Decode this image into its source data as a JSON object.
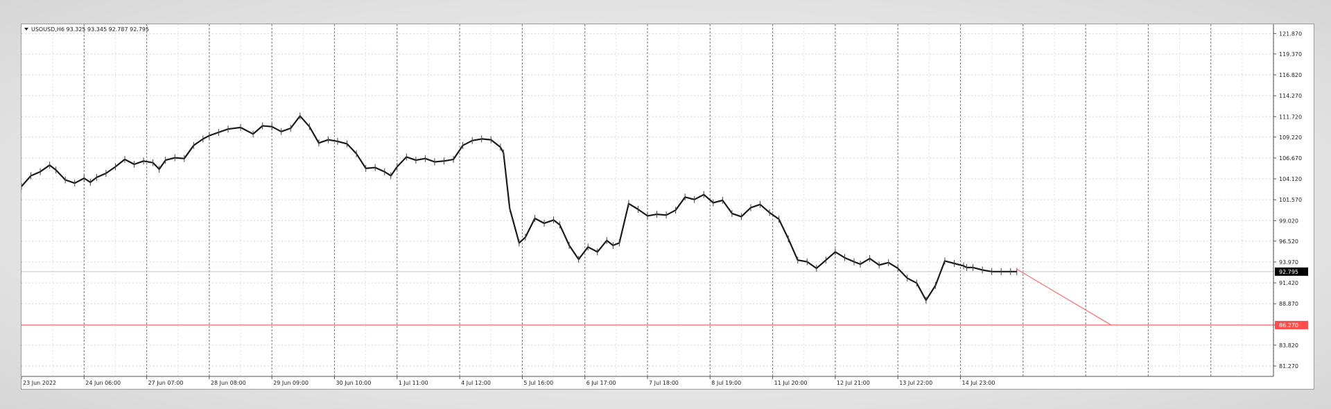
{
  "chart_data": {
    "type": "line",
    "header": "USOUSD,H6  93.325 93.345 92.787 92.795",
    "symbol": "USOUSD,H6",
    "ohlc": {
      "open": 93.325,
      "high": 93.345,
      "low": 92.787,
      "close": 92.795
    },
    "ylim": [
      80.0,
      123.0
    ],
    "y_ticks": [
      "121.870",
      "119.370",
      "116.820",
      "114.270",
      "111.720",
      "109.220",
      "106.670",
      "104.120",
      "101.570",
      "99.020",
      "96.520",
      "93.970",
      "91.420",
      "88.870",
      "86.270",
      "83.820",
      "81.270"
    ],
    "x_ticks": [
      "23 Jun 2022",
      "24 Jun 06:00",
      "27 Jun 07:00",
      "28 Jun 08:00",
      "29 Jun 09:00",
      "30 Jun 10:00",
      "1 Jul 11:00",
      "4 Jul 12:00",
      "5 Jul 16:00",
      "6 Jul 17:00",
      "7 Jul 18:00",
      "8 Jul 19:00",
      "11 Jul 20:00",
      "12 Jul 21:00",
      "13 Jul 22:00",
      "14 Jul 23:00"
    ],
    "x_domain": [
      0,
      20
    ],
    "grid": true,
    "series": [
      {
        "type": "price",
        "color": "#1a1a1a",
        "x": [
          0,
          0.15,
          0.3,
          0.45,
          0.55,
          0.7,
          0.85,
          1,
          1.1,
          1.2,
          1.35,
          1.5,
          1.65,
          1.8,
          1.95,
          2.1,
          2.2,
          2.3,
          2.45,
          2.6,
          2.75,
          2.9,
          3.0,
          3.15,
          3.3,
          3.5,
          3.7,
          3.85,
          4.0,
          4.15,
          4.3,
          4.45,
          4.6,
          4.75,
          4.9,
          5.05,
          5.2,
          5.35,
          5.5,
          5.65,
          5.8,
          5.9,
          6.0,
          6.15,
          6.3,
          6.45,
          6.6,
          6.75,
          6.9,
          7.05,
          7.2,
          7.35,
          7.5,
          7.65,
          7.7,
          7.8,
          7.95,
          8.05,
          8.2,
          8.35,
          8.5,
          8.6,
          8.75,
          8.9,
          9.05,
          9.2,
          9.35,
          9.45,
          9.55,
          9.7,
          9.85,
          10.0,
          10.15,
          10.3,
          10.45,
          10.6,
          10.75,
          10.9,
          11.05,
          11.2,
          11.35,
          11.5,
          11.65,
          11.8,
          11.95,
          12.1,
          12.25,
          12.4,
          12.55,
          12.7,
          12.85,
          13.0,
          13.15,
          13.3,
          13.4,
          13.55,
          13.7,
          13.85,
          14.0,
          14.15,
          14.3,
          14.45,
          14.6,
          14.75,
          14.9,
          15.05,
          15.1,
          15.2,
          15.35,
          15.5,
          15.65,
          15.8,
          15.9
        ],
        "y": [
          103.2,
          104.5,
          105.0,
          105.8,
          105.2,
          104.0,
          103.6,
          104.2,
          103.7,
          104.3,
          104.8,
          105.6,
          106.5,
          105.9,
          106.3,
          106.1,
          105.3,
          106.4,
          106.7,
          106.6,
          108.2,
          109.0,
          109.4,
          109.8,
          110.2,
          110.4,
          109.6,
          110.6,
          110.5,
          109.9,
          110.3,
          111.8,
          110.5,
          108.5,
          108.9,
          108.7,
          108.4,
          107.2,
          105.4,
          105.5,
          105.0,
          104.5,
          105.6,
          106.8,
          106.4,
          106.6,
          106.2,
          106.3,
          106.5,
          108.2,
          108.8,
          109.0,
          108.9,
          108.0,
          107.3,
          100.5,
          96.3,
          97.0,
          99.3,
          98.7,
          99.1,
          98.5,
          96.0,
          94.3,
          95.8,
          95.2,
          96.6,
          96.0,
          96.3,
          101.1,
          100.4,
          99.6,
          99.8,
          99.7,
          100.3,
          101.9,
          101.6,
          102.2,
          101.2,
          101.5,
          99.9,
          99.5,
          100.6,
          101.0,
          100.0,
          99.2,
          96.8,
          94.2,
          94.0,
          93.2,
          94.2,
          95.2,
          94.5,
          94.0,
          93.7,
          94.4,
          93.6,
          93.9,
          93.2,
          92.0,
          91.4,
          89.3,
          91.1,
          94.1,
          93.8,
          93.5,
          93.3,
          93.3,
          93.0,
          92.8,
          92.8,
          92.8,
          92.8
        ]
      },
      {
        "type": "projection",
        "color": "#f07070",
        "x": [
          15.9,
          17.4
        ],
        "y": [
          93.1,
          86.3
        ]
      }
    ],
    "horizontal_line": {
      "value": 86.27,
      "color": "#ff4d4d",
      "label": "86.270"
    },
    "current_price": {
      "label": "92.795",
      "bg": "#000000",
      "fg": "#ffffff"
    },
    "accent_colors": {
      "grid_vertical": "#8a8a8a",
      "grid_horizontal": "#d2d2d2",
      "background": "#ffffff"
    }
  }
}
